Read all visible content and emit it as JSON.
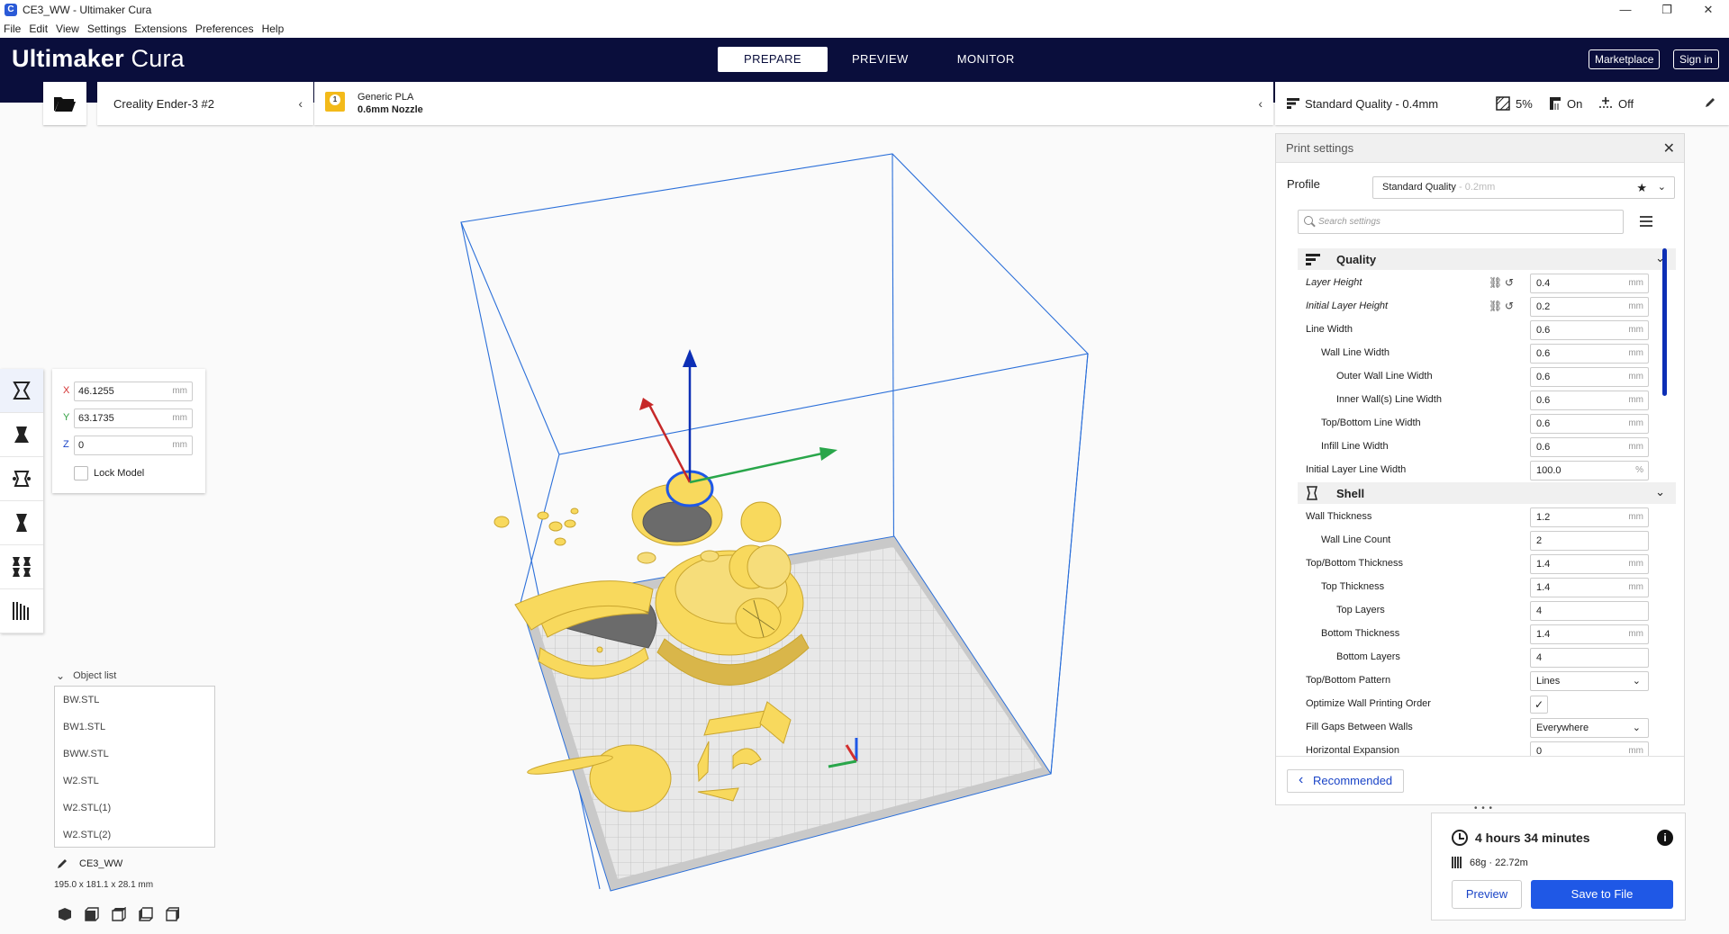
{
  "window": {
    "title": "CE3_WW - Ultimaker Cura",
    "minimize": "—",
    "maximize": "❐",
    "close": "✕"
  },
  "menu": [
    "File",
    "Edit",
    "View",
    "Settings",
    "Extensions",
    "Preferences",
    "Help"
  ],
  "brand": {
    "bold": "Ultimaker",
    "light": " Cura"
  },
  "stages": {
    "prepare": "PREPARE",
    "preview": "PREVIEW",
    "monitor": "MONITOR"
  },
  "header_buttons": {
    "marketplace": "Marketplace",
    "sign_in": "Sign in"
  },
  "printer": {
    "name": "Creality Ender-3 #2"
  },
  "material": {
    "name": "Generic PLA",
    "nozzle": "0.6mm Nozzle",
    "badge": "1"
  },
  "print_setup": {
    "profile": "Standard Quality - 0.4mm",
    "infill": "5%",
    "support": "On",
    "adhesion": "Off"
  },
  "print_settings": {
    "title": "Print settings",
    "profile_label": "Profile",
    "profile_value": "Standard Quality",
    "profile_suffix": " - 0.2mm",
    "search_placeholder": "Search settings",
    "categories": {
      "quality": "Quality",
      "shell": "Shell"
    },
    "quality_rows": [
      {
        "label": "Layer Height",
        "value": "0.4",
        "unit": "mm"
      },
      {
        "label": "Initial Layer Height",
        "value": "0.2",
        "unit": "mm"
      },
      {
        "label": "Line Width",
        "value": "0.6",
        "unit": "mm"
      },
      {
        "label": "Wall Line Width",
        "value": "0.6",
        "unit": "mm"
      },
      {
        "label": "Outer Wall Line Width",
        "value": "0.6",
        "unit": "mm"
      },
      {
        "label": "Inner Wall(s) Line Width",
        "value": "0.6",
        "unit": "mm"
      },
      {
        "label": "Top/Bottom Line Width",
        "value": "0.6",
        "unit": "mm"
      },
      {
        "label": "Infill Line Width",
        "value": "0.6",
        "unit": "mm"
      },
      {
        "label": "Initial Layer Line Width",
        "value": "100.0",
        "unit": "%"
      }
    ],
    "shell_rows": [
      {
        "label": "Wall Thickness",
        "value": "1.2",
        "unit": "mm"
      },
      {
        "label": "Wall Line Count",
        "value": "2",
        "unit": ""
      },
      {
        "label": "Top/Bottom Thickness",
        "value": "1.4",
        "unit": "mm"
      },
      {
        "label": "Top Thickness",
        "value": "1.4",
        "unit": "mm"
      },
      {
        "label": "Top Layers",
        "value": "4",
        "unit": ""
      },
      {
        "label": "Bottom Thickness",
        "value": "1.4",
        "unit": "mm"
      },
      {
        "label": "Bottom Layers",
        "value": "4",
        "unit": ""
      },
      {
        "label": "Top/Bottom Pattern",
        "value": "Lines"
      },
      {
        "label": "Optimize Wall Printing Order",
        "checked": "✓"
      },
      {
        "label": "Fill Gaps Between Walls",
        "value": "Everywhere"
      },
      {
        "label": "Horizontal Expansion",
        "value": "0",
        "unit": "mm"
      }
    ],
    "recommended": "Recommended"
  },
  "action": {
    "time": "4 hours 34 minutes",
    "material": "68g · 22.72m",
    "preview": "Preview",
    "save": "Save to File",
    "info": "i"
  },
  "move_tool": {
    "x_axis": "X",
    "x": "46.1255",
    "y_axis": "Y",
    "y": "63.1735",
    "z_axis": "Z",
    "z": "0",
    "unit": "mm",
    "lock": "Lock Model"
  },
  "object_list": {
    "header": "Object list",
    "items": [
      "BW.STL",
      "BW1.STL",
      "BWW.STL",
      "W2.STL",
      "W2.STL(1)",
      "W2.STL(2)"
    ]
  },
  "job": {
    "name": "CE3_WW",
    "dimensions": "195.0 x 181.1 x 28.1 mm"
  },
  "colors": {
    "header": "#0a0e3c",
    "accent": "#1f58e6",
    "model": "#f8d95d",
    "material_badge": "#f3ba1a"
  }
}
